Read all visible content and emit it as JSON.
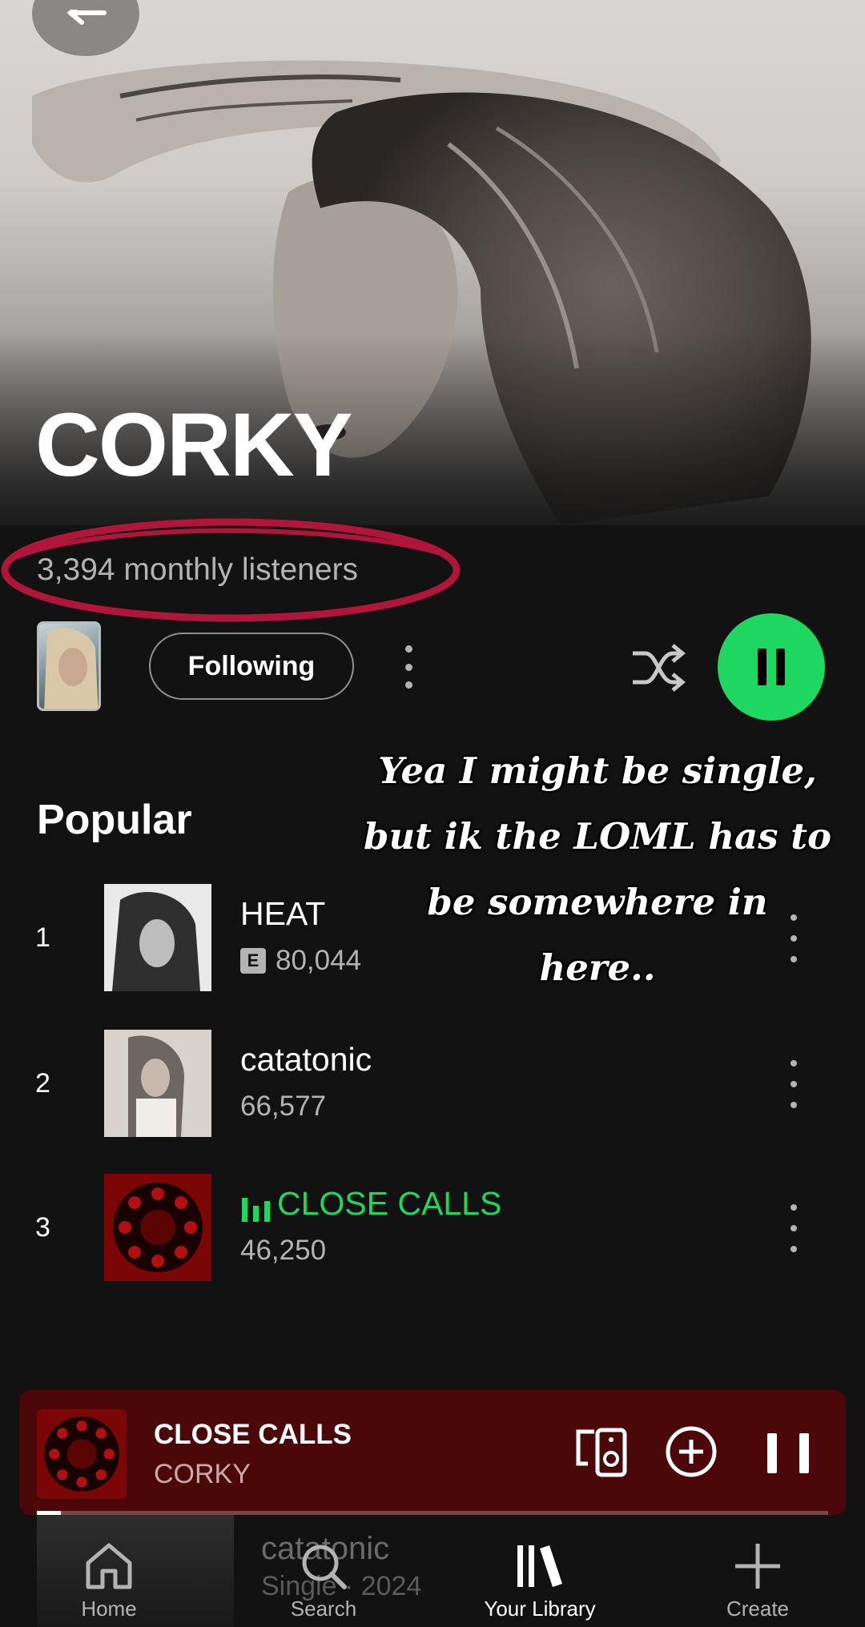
{
  "artist": {
    "name": "CORKY",
    "monthly_listeners": "3,394 monthly listeners"
  },
  "actions": {
    "follow_label": "Following"
  },
  "caption": {
    "line1": "Yea I might be single,",
    "line2": "but ik the LOML has to",
    "line3": "be somewhere in",
    "line4": "here.."
  },
  "popular": {
    "title": "Popular",
    "tracks": [
      {
        "num": "1",
        "title": "HEAT",
        "plays": "80,044",
        "explicit": true,
        "explicit_label": "E"
      },
      {
        "num": "2",
        "title": "catatonic",
        "plays": "66,577",
        "explicit": false
      },
      {
        "num": "3",
        "title": "CLOSE CALLS",
        "plays": "46,250",
        "explicit": false,
        "playing": true
      }
    ]
  },
  "mini_player": {
    "title": "CLOSE CALLS",
    "artist": "CORKY",
    "progress": 0.03
  },
  "nav": {
    "behind_title": "catatonic",
    "behind_sub": "Single · 2024",
    "items": [
      {
        "label": "Home",
        "icon": "home-icon"
      },
      {
        "label": "Search",
        "icon": "search-icon"
      },
      {
        "label": "Your Library",
        "icon": "library-icon"
      },
      {
        "label": "Create",
        "icon": "plus-icon"
      }
    ]
  },
  "colors": {
    "accent": "#1ed760",
    "background": "#121212",
    "mini_player_bg": "#4c0708",
    "highlight_oval": "#b0163a"
  }
}
